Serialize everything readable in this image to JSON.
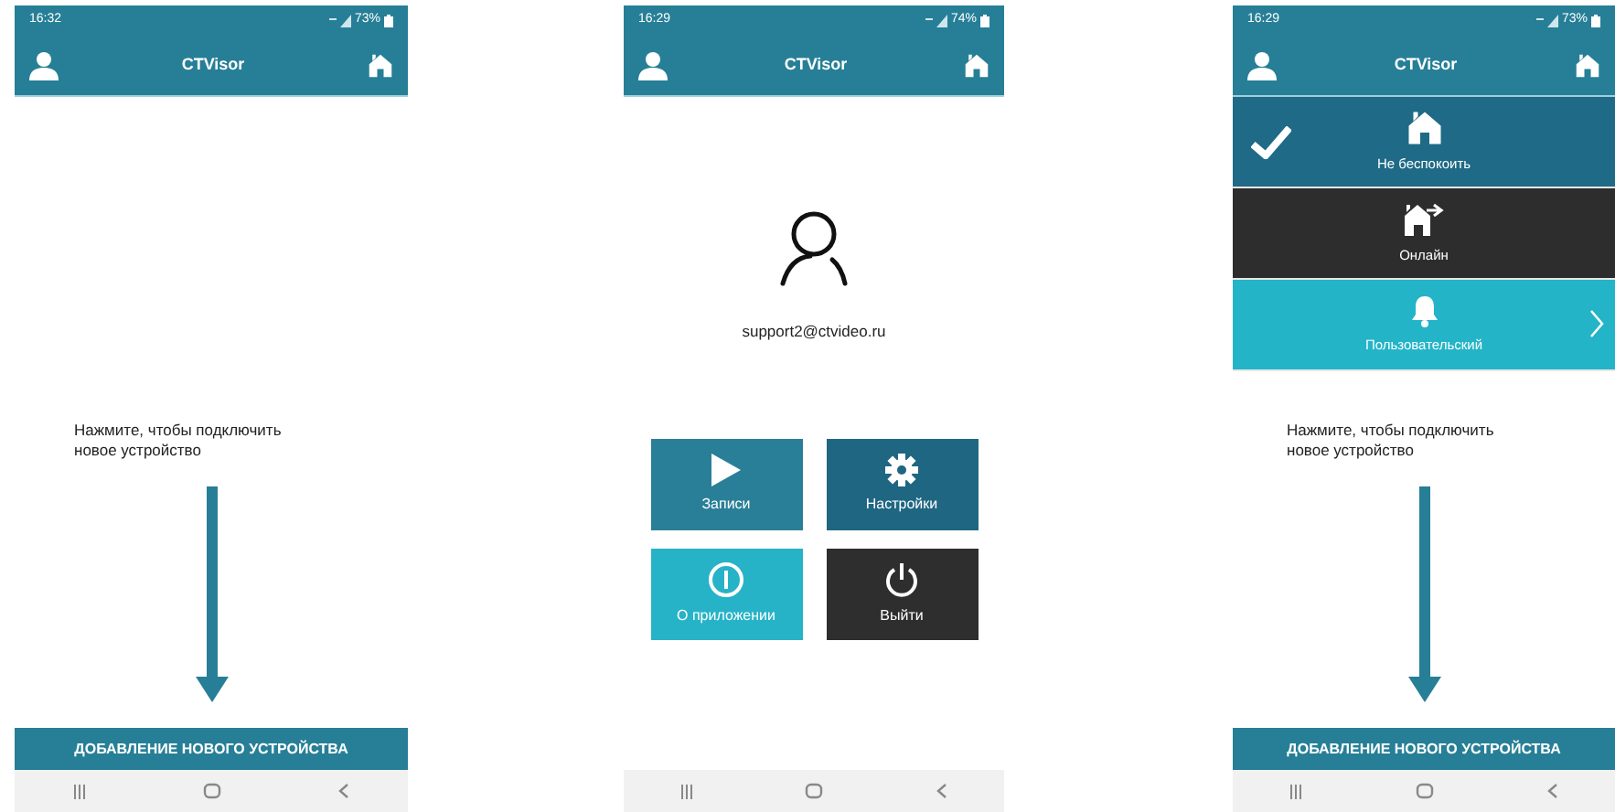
{
  "screens": [
    {
      "kind": "devices",
      "status_bar": {
        "time": "16:32",
        "battery": "73%"
      },
      "app_bar": {
        "title": "CTVisor"
      },
      "hint": "Нажмите, чтобы подключить новое устройство",
      "add_button": "ДОБАВЛЕНИЕ НОВОГО УСТРОЙСТВА"
    },
    {
      "kind": "profile",
      "status_bar": {
        "time": "16:29",
        "battery": "74%"
      },
      "app_bar": {
        "title": "CTVisor"
      },
      "email": "support2@ctvideo.ru",
      "tiles": [
        {
          "label": "Записи",
          "kind": "play",
          "color": "#2a7f98"
        },
        {
          "label": "Настройки",
          "kind": "gear",
          "color": "#1f6682"
        },
        {
          "label": "О приложении",
          "kind": "info",
          "color": "#27b3c7"
        },
        {
          "label": "Выйти",
          "kind": "power",
          "color": "#2e2e2e"
        }
      ]
    },
    {
      "kind": "mode_menu",
      "status_bar": {
        "time": "16:29",
        "battery": "73%"
      },
      "app_bar": {
        "title": "CTVisor"
      },
      "modes": [
        {
          "label": "Не беспокоить",
          "kind": "home",
          "color": "#1f6a86",
          "selected": true,
          "has_submenu": false
        },
        {
          "label": "Онлайн",
          "kind": "home-arrow",
          "color": "#2d2d2d",
          "selected": false,
          "has_submenu": false
        },
        {
          "label": "Пользовательский",
          "kind": "bell",
          "color": "#23b4c8",
          "selected": false,
          "has_submenu": true
        }
      ],
      "hint": "Нажмите, чтобы подключить новое устройство",
      "add_button": "ДОБАВЛЕНИЕ НОВОГО УСТРОЙСТВА"
    }
  ]
}
